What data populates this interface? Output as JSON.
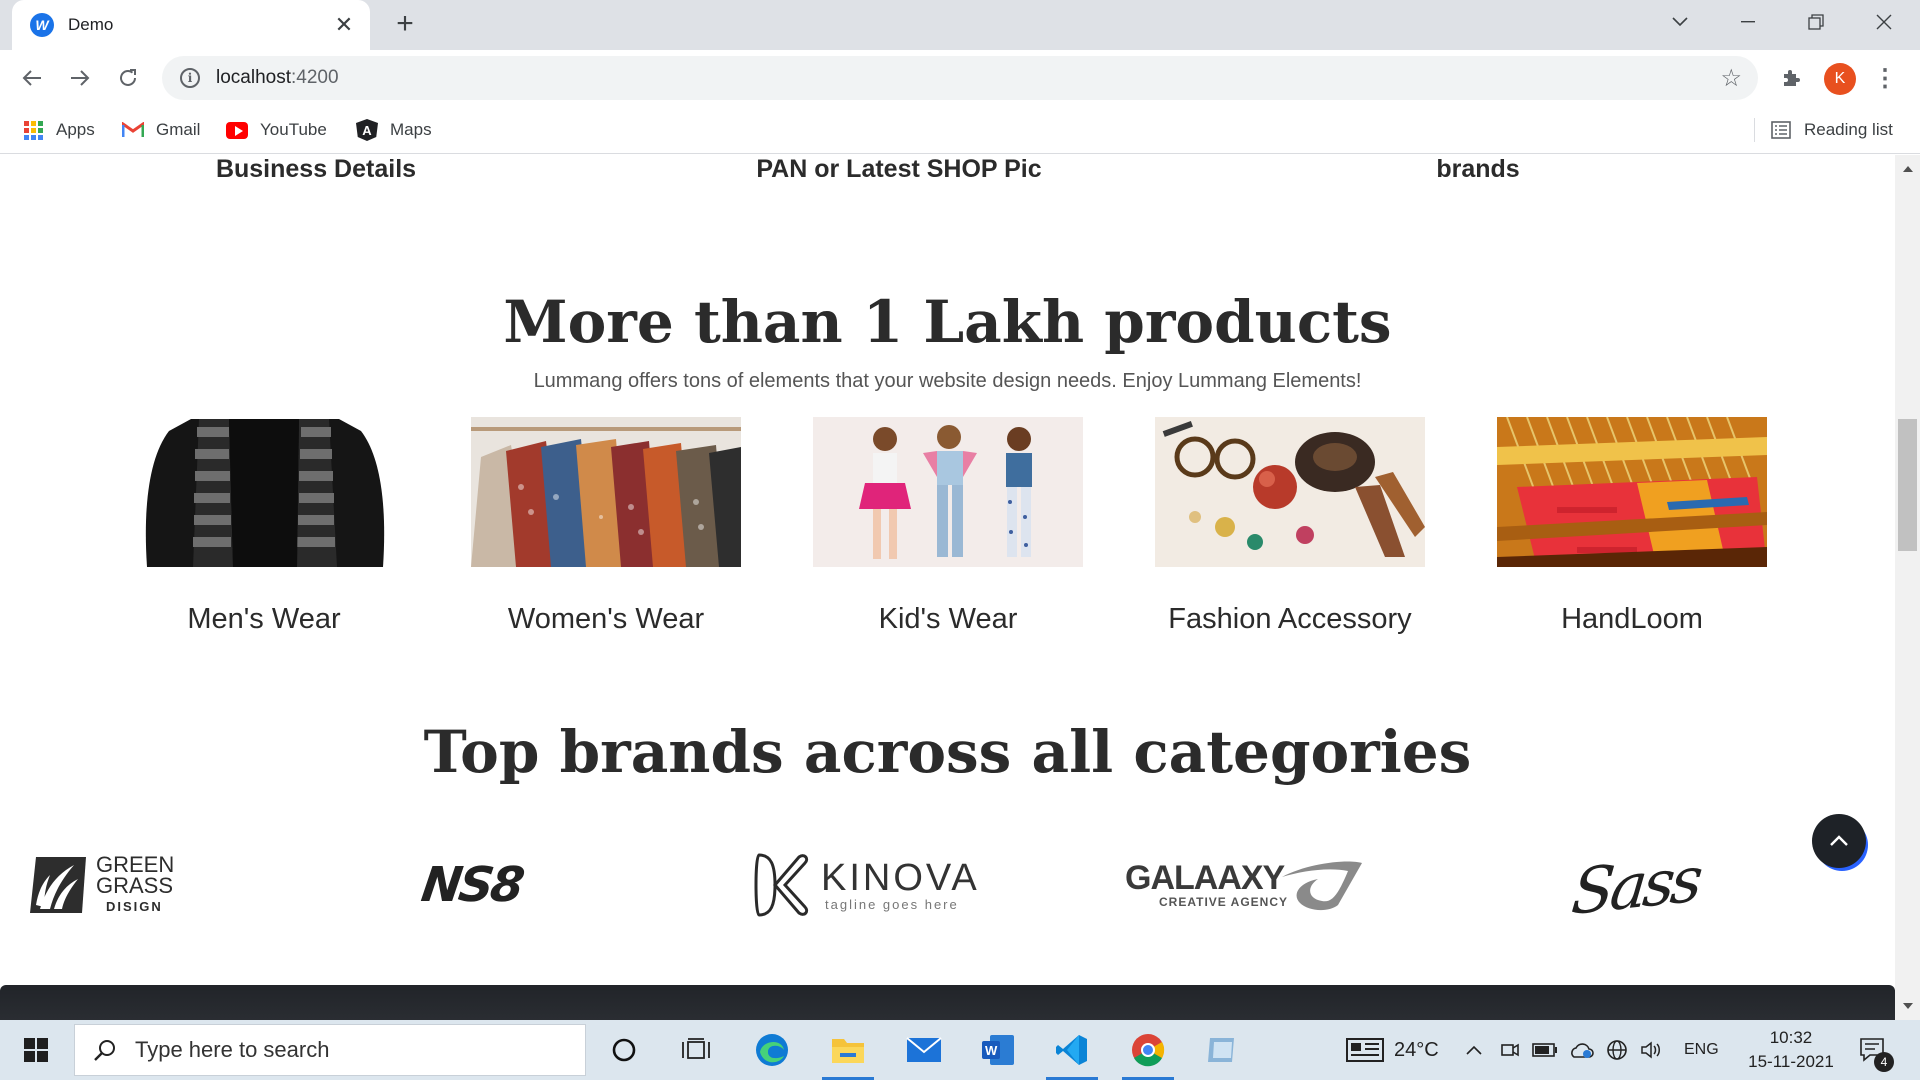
{
  "browser": {
    "tab_title": "Demo",
    "tab_favicon": "W",
    "url_host": "localhost",
    "url_port": ":4200",
    "profile_initial": "K",
    "bookmarks": [
      {
        "label": "Apps",
        "icon": "apps-grid-icon"
      },
      {
        "label": "Gmail",
        "icon": "gmail-icon"
      },
      {
        "label": "YouTube",
        "icon": "youtube-icon"
      },
      {
        "label": "Maps",
        "icon": "angular-icon"
      }
    ],
    "reading_list": "Reading list"
  },
  "page": {
    "steps": [
      "Business Details",
      "PAN or Latest SHOP Pic",
      "brands"
    ],
    "products_heading": "More than 1 Lakh products",
    "products_subtitle": "Lummang offers tons of elements that your website design needs. Enjoy Lummang Elements!",
    "categories": [
      {
        "label": "Men's Wear"
      },
      {
        "label": "Women's Wear"
      },
      {
        "label": "Kid's Wear"
      },
      {
        "label": "Fashion Accessory"
      },
      {
        "label": "HandLoom"
      }
    ],
    "brands_heading": "Top brands across all categories",
    "brands": [
      {
        "line1": "GREEN",
        "line2": "GRASS",
        "line3": "DISIGN"
      },
      {
        "name": "NS8"
      },
      {
        "name": "KINOVA",
        "tagline": "tagline goes here"
      },
      {
        "name": "GALAAXY",
        "tagline": "CREATIVE AGENCY"
      },
      {
        "name": "Sass"
      }
    ]
  },
  "taskbar": {
    "search_placeholder": "Type here to search",
    "weather": "24°C",
    "language": "ENG",
    "time": "10:32",
    "date": "15-11-2021",
    "notifications": "4"
  },
  "colors": {
    "accent_blue": "#1a73e8",
    "profile": "#e8501f",
    "heading": "#2b2b2b",
    "footer_band": "#212429"
  }
}
